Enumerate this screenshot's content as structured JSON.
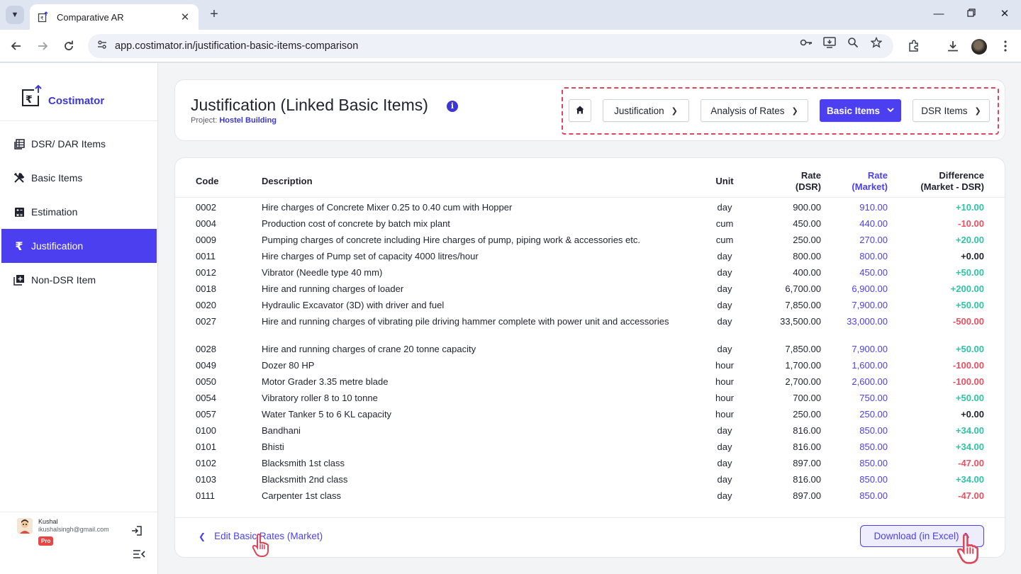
{
  "browser": {
    "tab_title": "Comparative AR",
    "url": "app.costimator.in/justification-basic-items-comparison"
  },
  "brand": {
    "name": "Costimator"
  },
  "sidebar": {
    "items": [
      {
        "label": "DSR/ DAR Items",
        "icon": "table-icon",
        "active": false
      },
      {
        "label": "Basic Items",
        "icon": "tools-icon",
        "active": false
      },
      {
        "label": "Estimation",
        "icon": "calculator-icon",
        "active": false
      },
      {
        "label": "Justification",
        "icon": "rupee-icon",
        "active": true
      },
      {
        "label": "Non-DSR Item",
        "icon": "add-box-icon",
        "active": false
      }
    ],
    "user": {
      "name": "Kushal",
      "email": "ikushalsingh@gmail.com",
      "badge": "Pro"
    }
  },
  "header": {
    "title": "Justification (Linked Basic Items)",
    "project_label": "Project:",
    "project_name": "Hostel Building",
    "breadcrumbs": [
      {
        "label": "Justification"
      },
      {
        "label": "Analysis of Rates"
      },
      {
        "label": "Basic Items",
        "active": true
      },
      {
        "label": "DSR Items"
      }
    ]
  },
  "table": {
    "headers": {
      "code": "Code",
      "description": "Description",
      "unit": "Unit",
      "rate_dsr_1": "Rate",
      "rate_dsr_2": "(DSR)",
      "rate_market_1": "Rate",
      "rate_market_2": "(Market)",
      "diff_1": "Difference",
      "diff_2": "(Market - DSR)"
    },
    "rows": [
      {
        "code": "0002",
        "description": "Hire charges of Concrete Mixer 0.25 to 0.40 cum with Hopper",
        "unit": "day",
        "dsr": "900.00",
        "market": "910.00",
        "diff": "+10.00"
      },
      {
        "code": "0004",
        "description": "Production cost of concrete by batch mix plant",
        "unit": "cum",
        "dsr": "450.00",
        "market": "440.00",
        "diff": "-10.00"
      },
      {
        "code": "0009",
        "description": "Pumping charges of concrete including Hire charges of pump, piping work & accessories etc.",
        "unit": "cum",
        "dsr": "250.00",
        "market": "270.00",
        "diff": "+20.00"
      },
      {
        "code": "0011",
        "description": "Hire charges of Pump set of capacity 4000 litres/hour",
        "unit": "day",
        "dsr": "800.00",
        "market": "800.00",
        "diff": "+0.00"
      },
      {
        "code": "0012",
        "description": "Vibrator (Needle type 40 mm)",
        "unit": "day",
        "dsr": "400.00",
        "market": "450.00",
        "diff": "+50.00"
      },
      {
        "code": "0018",
        "description": "Hire and running charges of loader",
        "unit": "day",
        "dsr": "6,700.00",
        "market": "6,900.00",
        "diff": "+200.00"
      },
      {
        "code": "0020",
        "description": "Hydraulic Excavator (3D) with driver and fuel",
        "unit": "day",
        "dsr": "7,850.00",
        "market": "7,900.00",
        "diff": "+50.00"
      },
      {
        "code": "0027",
        "description": "Hire and running charges of vibrating pile driving hammer complete with power unit and accessories",
        "unit": "day",
        "dsr": "33,500.00",
        "market": "33,000.00",
        "diff": "-500.00"
      },
      {
        "code": "0028",
        "description": "Hire and running charges of crane 20 tonne capacity",
        "unit": "day",
        "dsr": "7,850.00",
        "market": "7,900.00",
        "diff": "+50.00"
      },
      {
        "code": "0049",
        "description": "Dozer 80 HP",
        "unit": "hour",
        "dsr": "1,700.00",
        "market": "1,600.00",
        "diff": "-100.00"
      },
      {
        "code": "0050",
        "description": "Motor Grader 3.35 metre blade",
        "unit": "hour",
        "dsr": "2,700.00",
        "market": "2,600.00",
        "diff": "-100.00"
      },
      {
        "code": "0054",
        "description": "Vibratory roller 8 to 10 tonne",
        "unit": "hour",
        "dsr": "700.00",
        "market": "750.00",
        "diff": "+50.00"
      },
      {
        "code": "0057",
        "description": "Water Tanker 5 to 6 KL capacity",
        "unit": "hour",
        "dsr": "250.00",
        "market": "250.00",
        "diff": "+0.00"
      },
      {
        "code": "0100",
        "description": "Bandhani",
        "unit": "day",
        "dsr": "816.00",
        "market": "850.00",
        "diff": "+34.00"
      },
      {
        "code": "0101",
        "description": "Bhisti",
        "unit": "day",
        "dsr": "816.00",
        "market": "850.00",
        "diff": "+34.00"
      },
      {
        "code": "0102",
        "description": "Blacksmith 1st class",
        "unit": "day",
        "dsr": "897.00",
        "market": "850.00",
        "diff": "-47.00"
      },
      {
        "code": "0103",
        "description": "Blacksmith 2nd class",
        "unit": "day",
        "dsr": "816.00",
        "market": "850.00",
        "diff": "+34.00"
      },
      {
        "code": "0111",
        "description": "Carpenter 1st class",
        "unit": "day",
        "dsr": "897.00",
        "market": "850.00",
        "diff": "-47.00"
      }
    ]
  },
  "footer": {
    "edit_link": "Edit Basic Rates (Market)",
    "download_button": "Download (in Excel)"
  },
  "colors": {
    "accent": "#4b3ff0",
    "positive": "#2ec4a4",
    "negative": "#ec5060",
    "highlight_dash": "#e0445a"
  }
}
